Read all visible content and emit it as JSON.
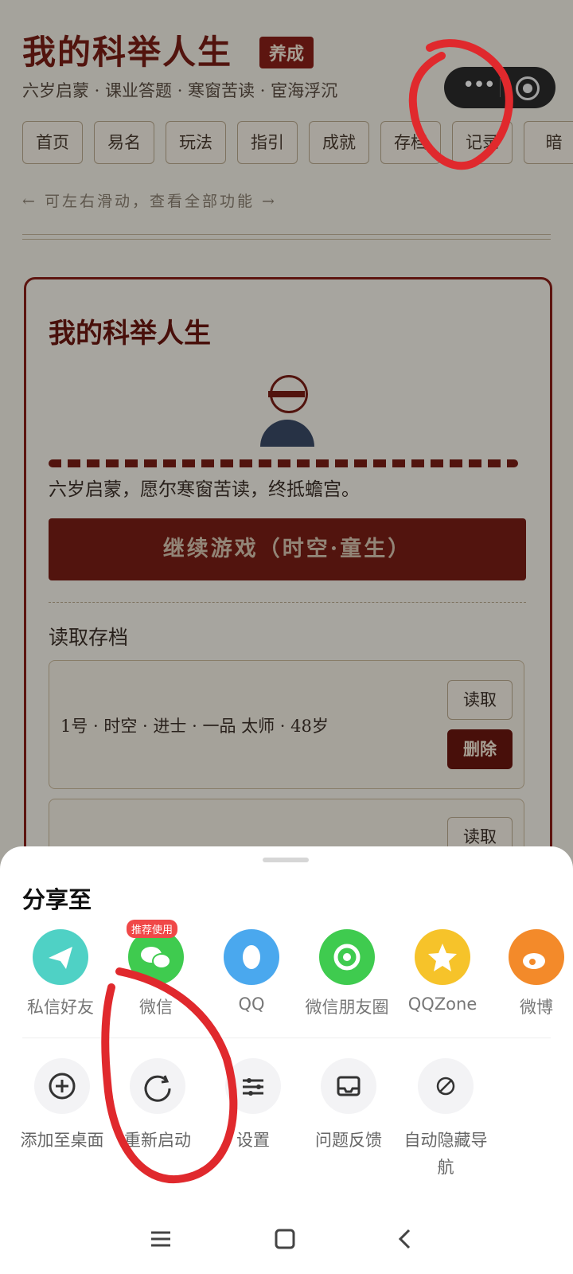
{
  "header": {
    "title": "我的科举人生",
    "badge": "养成",
    "subtitle": "六岁启蒙 · 课业答题 · 寒窗苦读 · 宦海浮沉"
  },
  "nav": [
    "首页",
    "易名",
    "玩法",
    "指引",
    "成就",
    "存档",
    "记录",
    "暗"
  ],
  "nav_hint": "← 可左右滑动，查看全部功能 →",
  "card": {
    "title": "我的科举人生",
    "motto": "六岁启蒙，愿尔寒窗苦读，终抵蟾宫。",
    "continue_label": "继续游戏（时空·童生）",
    "read_title": "读取存档",
    "slots": [
      {
        "text": "1号 · 时空 · 进士 · 一品 太师 · 48岁",
        "read_label": "读取",
        "delete_label": "删除"
      },
      {
        "text": "",
        "read_label": "读取"
      }
    ]
  },
  "sheet": {
    "title": "分享至",
    "recommend_badge": "推荐使用",
    "share_targets": [
      {
        "label": "私信好友",
        "icon": "paper-plane-icon",
        "color": "#4fd1c5"
      },
      {
        "label": "微信",
        "icon": "wechat-icon",
        "color": "#3fcb4f"
      },
      {
        "label": "QQ",
        "icon": "qq-penguin-icon",
        "color": "#4aa8ee"
      },
      {
        "label": "微信朋友圈",
        "icon": "moments-shutter-icon",
        "color": "#3fcb4f"
      },
      {
        "label": "QQZone",
        "icon": "qzone-star-icon",
        "color": "#f6c32a"
      },
      {
        "label": "微博",
        "icon": "weibo-icon",
        "color": "#f38a2a"
      }
    ],
    "tools": [
      {
        "label": "添加至桌面",
        "icon": "add-circle-icon"
      },
      {
        "label": "重新启动",
        "icon": "refresh-icon"
      },
      {
        "label": "设置",
        "icon": "sliders-icon"
      },
      {
        "label": "问题反馈",
        "icon": "feedback-inbox-icon"
      },
      {
        "label": "自动隐藏导航",
        "icon": "hide-nav-icon"
      }
    ]
  },
  "colors": {
    "accent": "#7a1e16",
    "annotation": "#e0292d"
  }
}
